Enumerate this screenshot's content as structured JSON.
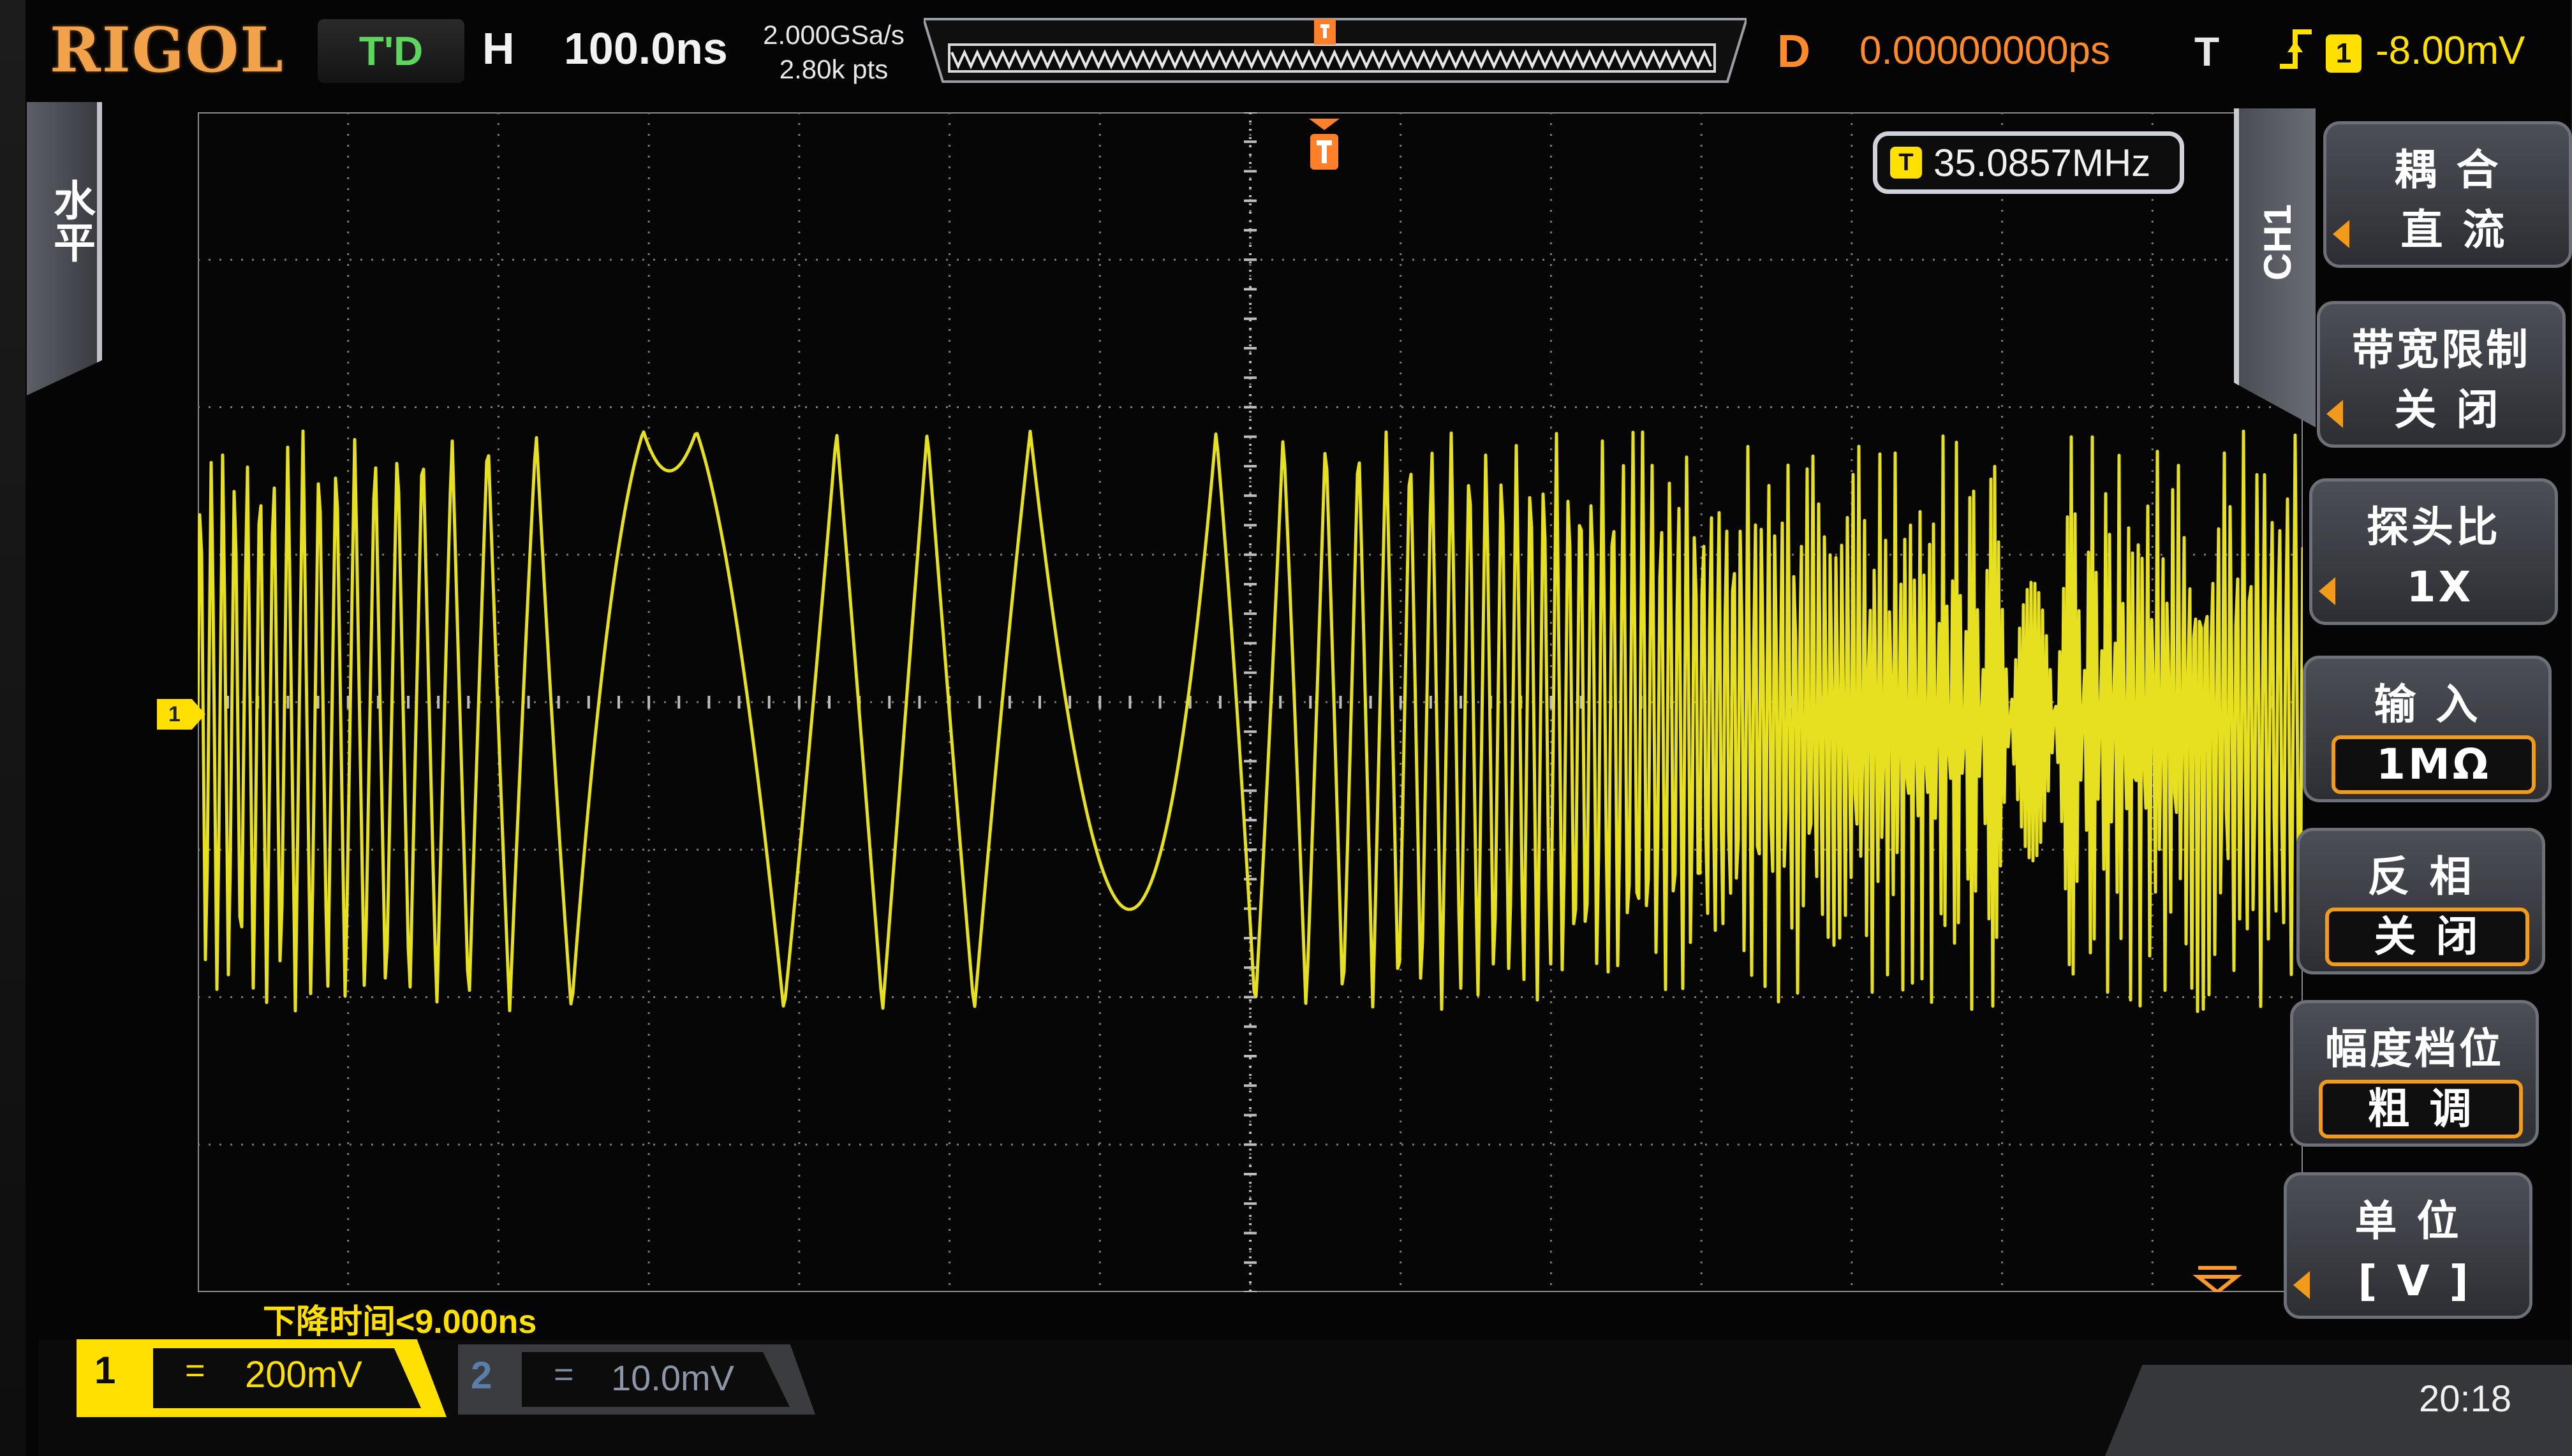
{
  "brand": "RIGOL",
  "top": {
    "run_state": "T'D",
    "horizontal_label": "H",
    "timebase": "100.0ns",
    "sample_rate": "2.000GSa/s",
    "mem_depth": "2.80k pts",
    "delay_label": "D",
    "delay_value": "0.00000000ps",
    "trigger_label": "T",
    "trigger_edge_icon": "rising-edge-icon",
    "trigger_channel": "1",
    "trigger_level": "-8.00mV"
  },
  "left_tab": {
    "label": "水平"
  },
  "display": {
    "frequency_badge": "T",
    "frequency": "35.0857MHz",
    "ch1_marker": "1",
    "fall_time": "下降时间<9.000ns",
    "grid_divisions": {
      "h": 14,
      "v": 8
    }
  },
  "menu": {
    "tab": "CH1",
    "items": [
      {
        "title": "耦 合",
        "value": "直 流",
        "boxed": false
      },
      {
        "title": "带宽限制",
        "value": "关 闭",
        "boxed": false
      },
      {
        "title": "探头比",
        "value": "1X",
        "boxed": false
      },
      {
        "title": "输 入",
        "value": "1MΩ",
        "boxed": true
      },
      {
        "title": "反 相",
        "value": "关 闭",
        "boxed": true
      },
      {
        "title": "幅度档位",
        "value": "粗 调",
        "boxed": true
      },
      {
        "title": "单 位",
        "value": "[ V ]",
        "boxed": false
      }
    ]
  },
  "bottom": {
    "ch1": {
      "num": "1",
      "coupling": "=",
      "scale": "200mV"
    },
    "ch2": {
      "num": "2",
      "coupling": "=",
      "scale": "10.0mV"
    },
    "clock": "20:18"
  },
  "colors": {
    "trace": "#e6e020",
    "ch1": "#ffe000",
    "accent": "#f29a1a",
    "brand": "#f2a24a"
  }
}
